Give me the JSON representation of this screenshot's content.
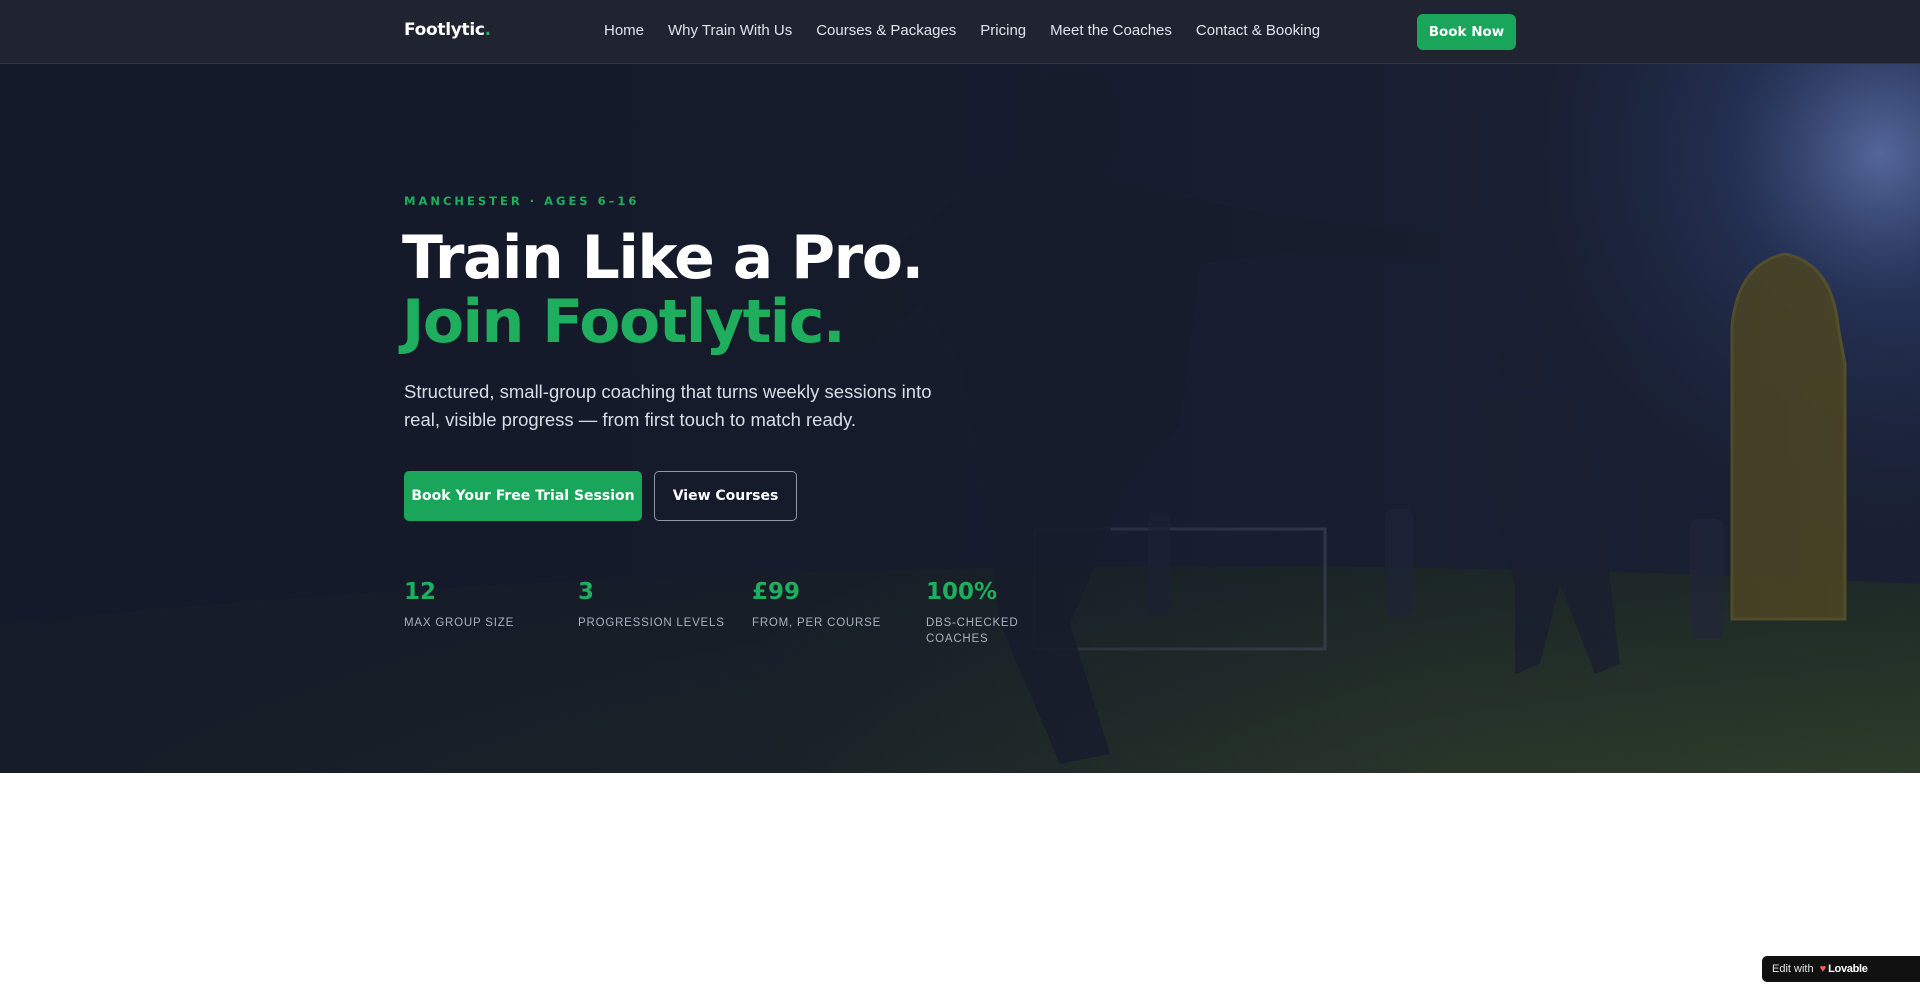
{
  "nav": {
    "logo_text": "Footlytic",
    "logo_dot": ".",
    "links": [
      "Home",
      "Why Train With Us",
      "Courses & Packages",
      "Pricing",
      "Meet the Coaches",
      "Contact & Booking"
    ],
    "cta_label": "Book Now"
  },
  "hero": {
    "eyebrow": "MANCHESTER · AGES 6–16",
    "title_line1": "Train Like a Pro.",
    "title_line2": "Join Footlytic.",
    "lead": "Structured, small-group coaching that turns weekly sessions into real, visible progress — from first touch to match ready.",
    "primary_cta": "Book Your Free Trial Session",
    "secondary_cta": "View Courses",
    "stats": [
      {
        "value": "12",
        "label": "MAX GROUP SIZE"
      },
      {
        "value": "3",
        "label": "PROGRESSION LEVELS"
      },
      {
        "value": "£99",
        "label": "FROM, PER COURSE"
      },
      {
        "value": "100%",
        "label": "DBS-CHECKED COACHES"
      }
    ]
  },
  "badge": {
    "prefix": "Edit with",
    "brand": "Lovable",
    "close": "✕"
  },
  "colors": {
    "accent": "#1fae5e",
    "nav_bg": "#1f2430",
    "hero_bg": "#14192a"
  }
}
